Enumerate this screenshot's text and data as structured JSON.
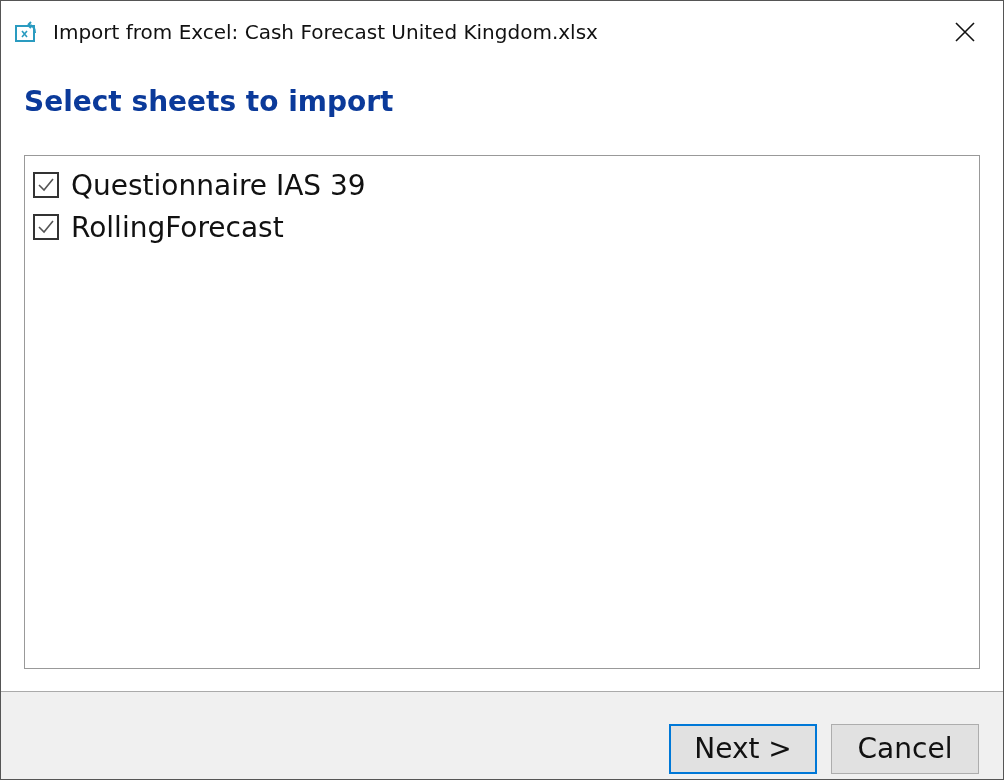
{
  "window": {
    "title": "Import from Excel: Cash Forecast United Kingdom.xlsx"
  },
  "heading": "Select sheets to import",
  "sheets": [
    {
      "label": "Questionnaire IAS 39",
      "checked": true
    },
    {
      "label": "RollingForecast",
      "checked": true
    }
  ],
  "buttons": [
    {
      "label": "Next >",
      "default": true
    },
    {
      "label": "Cancel",
      "default": false
    }
  ]
}
